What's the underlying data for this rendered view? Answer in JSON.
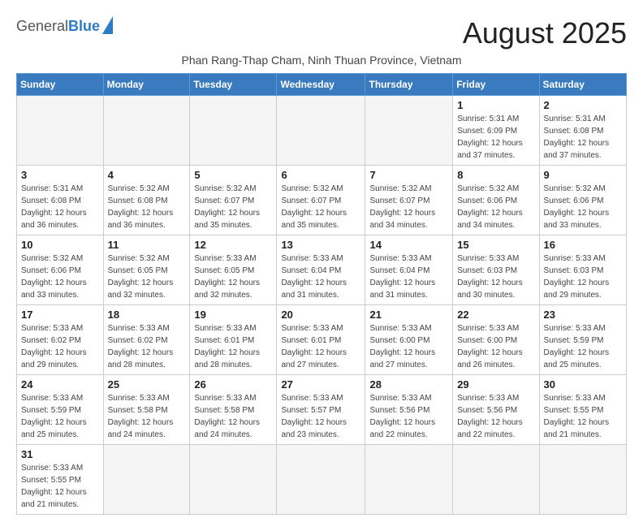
{
  "logo": {
    "text_general": "General",
    "text_blue": "Blue"
  },
  "title": "August 2025",
  "subtitle": "Phan Rang-Thap Cham, Ninh Thuan Province, Vietnam",
  "days_of_week": [
    "Sunday",
    "Monday",
    "Tuesday",
    "Wednesday",
    "Thursday",
    "Friday",
    "Saturday"
  ],
  "weeks": [
    [
      {
        "day": "",
        "info": ""
      },
      {
        "day": "",
        "info": ""
      },
      {
        "day": "",
        "info": ""
      },
      {
        "day": "",
        "info": ""
      },
      {
        "day": "",
        "info": ""
      },
      {
        "day": "1",
        "info": "Sunrise: 5:31 AM\nSunset: 6:09 PM\nDaylight: 12 hours and 37 minutes."
      },
      {
        "day": "2",
        "info": "Sunrise: 5:31 AM\nSunset: 6:08 PM\nDaylight: 12 hours and 37 minutes."
      }
    ],
    [
      {
        "day": "3",
        "info": "Sunrise: 5:31 AM\nSunset: 6:08 PM\nDaylight: 12 hours and 36 minutes."
      },
      {
        "day": "4",
        "info": "Sunrise: 5:32 AM\nSunset: 6:08 PM\nDaylight: 12 hours and 36 minutes."
      },
      {
        "day": "5",
        "info": "Sunrise: 5:32 AM\nSunset: 6:07 PM\nDaylight: 12 hours and 35 minutes."
      },
      {
        "day": "6",
        "info": "Sunrise: 5:32 AM\nSunset: 6:07 PM\nDaylight: 12 hours and 35 minutes."
      },
      {
        "day": "7",
        "info": "Sunrise: 5:32 AM\nSunset: 6:07 PM\nDaylight: 12 hours and 34 minutes."
      },
      {
        "day": "8",
        "info": "Sunrise: 5:32 AM\nSunset: 6:06 PM\nDaylight: 12 hours and 34 minutes."
      },
      {
        "day": "9",
        "info": "Sunrise: 5:32 AM\nSunset: 6:06 PM\nDaylight: 12 hours and 33 minutes."
      }
    ],
    [
      {
        "day": "10",
        "info": "Sunrise: 5:32 AM\nSunset: 6:06 PM\nDaylight: 12 hours and 33 minutes."
      },
      {
        "day": "11",
        "info": "Sunrise: 5:32 AM\nSunset: 6:05 PM\nDaylight: 12 hours and 32 minutes."
      },
      {
        "day": "12",
        "info": "Sunrise: 5:33 AM\nSunset: 6:05 PM\nDaylight: 12 hours and 32 minutes."
      },
      {
        "day": "13",
        "info": "Sunrise: 5:33 AM\nSunset: 6:04 PM\nDaylight: 12 hours and 31 minutes."
      },
      {
        "day": "14",
        "info": "Sunrise: 5:33 AM\nSunset: 6:04 PM\nDaylight: 12 hours and 31 minutes."
      },
      {
        "day": "15",
        "info": "Sunrise: 5:33 AM\nSunset: 6:03 PM\nDaylight: 12 hours and 30 minutes."
      },
      {
        "day": "16",
        "info": "Sunrise: 5:33 AM\nSunset: 6:03 PM\nDaylight: 12 hours and 29 minutes."
      }
    ],
    [
      {
        "day": "17",
        "info": "Sunrise: 5:33 AM\nSunset: 6:02 PM\nDaylight: 12 hours and 29 minutes."
      },
      {
        "day": "18",
        "info": "Sunrise: 5:33 AM\nSunset: 6:02 PM\nDaylight: 12 hours and 28 minutes."
      },
      {
        "day": "19",
        "info": "Sunrise: 5:33 AM\nSunset: 6:01 PM\nDaylight: 12 hours and 28 minutes."
      },
      {
        "day": "20",
        "info": "Sunrise: 5:33 AM\nSunset: 6:01 PM\nDaylight: 12 hours and 27 minutes."
      },
      {
        "day": "21",
        "info": "Sunrise: 5:33 AM\nSunset: 6:00 PM\nDaylight: 12 hours and 27 minutes."
      },
      {
        "day": "22",
        "info": "Sunrise: 5:33 AM\nSunset: 6:00 PM\nDaylight: 12 hours and 26 minutes."
      },
      {
        "day": "23",
        "info": "Sunrise: 5:33 AM\nSunset: 5:59 PM\nDaylight: 12 hours and 25 minutes."
      }
    ],
    [
      {
        "day": "24",
        "info": "Sunrise: 5:33 AM\nSunset: 5:59 PM\nDaylight: 12 hours and 25 minutes."
      },
      {
        "day": "25",
        "info": "Sunrise: 5:33 AM\nSunset: 5:58 PM\nDaylight: 12 hours and 24 minutes."
      },
      {
        "day": "26",
        "info": "Sunrise: 5:33 AM\nSunset: 5:58 PM\nDaylight: 12 hours and 24 minutes."
      },
      {
        "day": "27",
        "info": "Sunrise: 5:33 AM\nSunset: 5:57 PM\nDaylight: 12 hours and 23 minutes."
      },
      {
        "day": "28",
        "info": "Sunrise: 5:33 AM\nSunset: 5:56 PM\nDaylight: 12 hours and 22 minutes."
      },
      {
        "day": "29",
        "info": "Sunrise: 5:33 AM\nSunset: 5:56 PM\nDaylight: 12 hours and 22 minutes."
      },
      {
        "day": "30",
        "info": "Sunrise: 5:33 AM\nSunset: 5:55 PM\nDaylight: 12 hours and 21 minutes."
      }
    ],
    [
      {
        "day": "31",
        "info": "Sunrise: 5:33 AM\nSunset: 5:55 PM\nDaylight: 12 hours and 21 minutes."
      },
      {
        "day": "",
        "info": ""
      },
      {
        "day": "",
        "info": ""
      },
      {
        "day": "",
        "info": ""
      },
      {
        "day": "",
        "info": ""
      },
      {
        "day": "",
        "info": ""
      },
      {
        "day": "",
        "info": ""
      }
    ]
  ]
}
